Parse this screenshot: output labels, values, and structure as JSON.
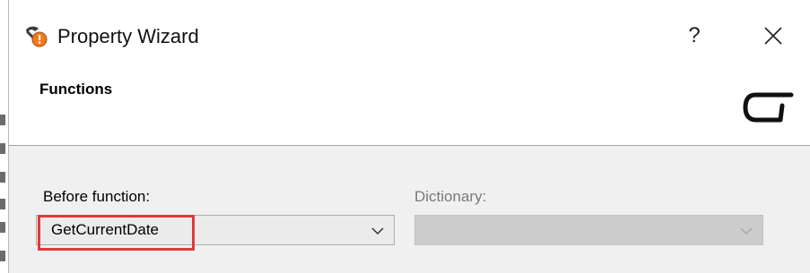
{
  "window": {
    "title": "Property Wizard",
    "help_label": "?",
    "close_label": "✕"
  },
  "header": {
    "title": "Functions"
  },
  "form": {
    "before_function": {
      "label": "Before function:",
      "value": "GetCurrentDate",
      "enabled": true
    },
    "dictionary": {
      "label": "Dictionary:",
      "value": "",
      "enabled": false
    }
  },
  "icons": {
    "app": "wizard-wand-icon",
    "header_logo": "brand-logo",
    "dropdown": "chevron-down-icon"
  },
  "colors": {
    "highlight": "#e0393c",
    "body_bg": "#f0f0f0",
    "icon_orange": "#f07b1f"
  }
}
